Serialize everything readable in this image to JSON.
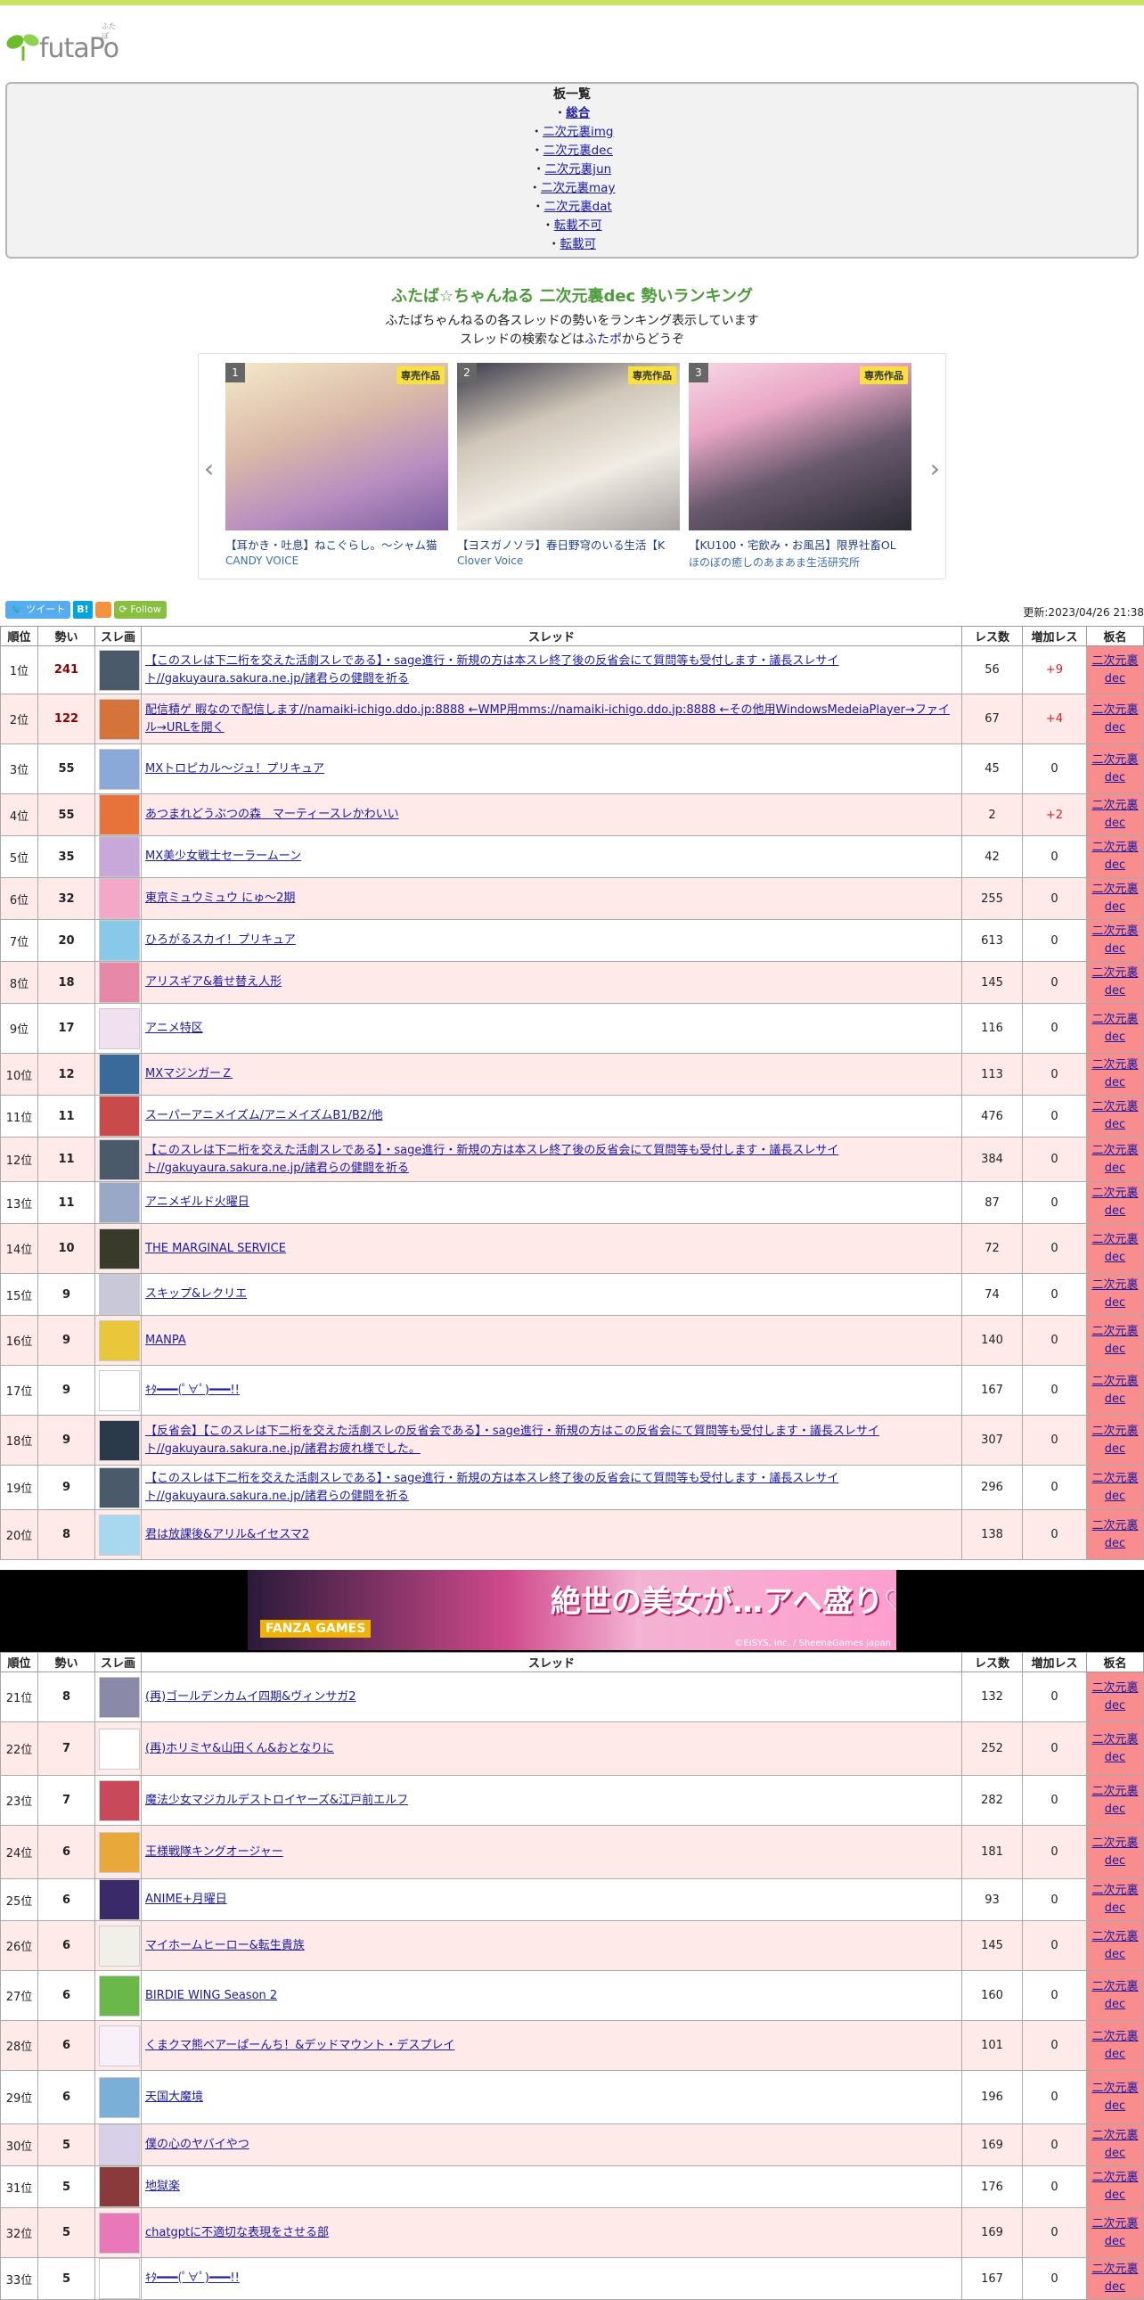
{
  "site": {
    "logo_text": "futaPo",
    "logo_kana": "ふたぽ"
  },
  "boards": {
    "heading": "板一覧",
    "items": [
      "総合",
      "二次元裏img",
      "二次元裏dec",
      "二次元裏jun",
      "二次元裏may",
      "二次元裏dat",
      "転載不可",
      "転載可"
    ]
  },
  "page": {
    "title": "ふたば☆ちゃんねる 二次元裏dec 勢いランキング",
    "desc1": "ふたばちゃんねるの各スレッドの勢いをランキング表示しています",
    "desc2_pre": "スレッドの検索などは",
    "desc2_link": "ふたポ",
    "desc2_post": "からどうぞ",
    "updated": "更新:2023/04/26 21:38"
  },
  "carousel": [
    {
      "num": "1",
      "tag": "専売作品",
      "title": "【耳かき・吐息】ねこぐらし。〜シャム猫",
      "circle": "CANDY VOICE"
    },
    {
      "num": "2",
      "tag": "専売作品",
      "title": "【ヨスガノソラ】春日野穹のいる生活【K",
      "circle": "Clover Voice"
    },
    {
      "num": "3",
      "tag": "専売作品",
      "title": "【KU100・宅飲み・お風呂】限界社畜OL",
      "circle": "ほのぼの癒しのあまあま生活研究所"
    }
  ],
  "social": {
    "tweet": "ツイート",
    "hatena": "B!",
    "follow": "Follow"
  },
  "table_headers": [
    "順位",
    "勢い",
    "スレ画",
    "スレッド",
    "レス数",
    "増加レス",
    "板名"
  ],
  "rows_a": [
    {
      "rank": "1位",
      "mom": "241",
      "title": "【このスレは下二桁を交えた活劇スレである】・sage進行・新規の方は本スレ終了後の反省会にて質問等も受付します・議長スレサイト//gakuyaura.sakura.ne.jp/諸君らの健闘を祈る",
      "res": "56",
      "inc": "+9",
      "board": "二次元裏dec"
    },
    {
      "rank": "2位",
      "mom": "122",
      "title": "配信積ゲ 暇なので配信します//namaiki-ichigo.ddo.jp:8888 ←WMP用mms://namaiki-ichigo.ddo.jp:8888 ←その他用WindowsMedeiaPlayer→ファイル→URLを開く",
      "res": "67",
      "inc": "+4",
      "board": "二次元裏dec"
    },
    {
      "rank": "3位",
      "mom": "55",
      "title": "MXトロピカル～ジュ！プリキュア",
      "res": "45",
      "inc": "0",
      "board": "二次元裏dec"
    },
    {
      "rank": "4位",
      "mom": "55",
      "title": "あつまれどうぶつの森　マーティースレかわいい",
      "res": "2",
      "inc": "+2",
      "board": "二次元裏dec"
    },
    {
      "rank": "5位",
      "mom": "35",
      "title": "MX美少女戦士セーラームーン",
      "res": "42",
      "inc": "0",
      "board": "二次元裏dec"
    },
    {
      "rank": "6位",
      "mom": "32",
      "title": "東京ミュウミュウ にゅ～2期",
      "res": "255",
      "inc": "0",
      "board": "二次元裏dec"
    },
    {
      "rank": "7位",
      "mom": "20",
      "title": "ひろがるスカイ！プリキュア",
      "res": "613",
      "inc": "0",
      "board": "二次元裏dec"
    },
    {
      "rank": "8位",
      "mom": "18",
      "title": "アリスギア&着せ替え人形",
      "res": "145",
      "inc": "0",
      "board": "二次元裏dec"
    },
    {
      "rank": "9位",
      "mom": "17",
      "title": "アニメ特区",
      "res": "116",
      "inc": "0",
      "board": "二次元裏dec"
    },
    {
      "rank": "10位",
      "mom": "12",
      "title": "MXマジンガーＺ",
      "res": "113",
      "inc": "0",
      "board": "二次元裏dec"
    },
    {
      "rank": "11位",
      "mom": "11",
      "title": "スーパーアニメイズム/アニメイズムB1/B2/他",
      "res": "476",
      "inc": "0",
      "board": "二次元裏dec"
    },
    {
      "rank": "12位",
      "mom": "11",
      "title": "【このスレは下二桁を交えた活劇スレである】・sage進行・新規の方は本スレ終了後の反省会にて質問等も受付します・議長スレサイト//gakuyaura.sakura.ne.jp/諸君らの健闘を祈る",
      "res": "384",
      "inc": "0",
      "board": "二次元裏dec"
    },
    {
      "rank": "13位",
      "mom": "11",
      "title": "アニメギルド火曜日",
      "res": "87",
      "inc": "0",
      "board": "二次元裏dec"
    },
    {
      "rank": "14位",
      "mom": "10",
      "title": "THE MARGINAL SERVICE",
      "res": "72",
      "inc": "0",
      "board": "二次元裏dec"
    },
    {
      "rank": "15位",
      "mom": "9",
      "title": "スキップ&レクリエ",
      "res": "74",
      "inc": "0",
      "board": "二次元裏dec"
    },
    {
      "rank": "16位",
      "mom": "9",
      "title": "MANPA",
      "res": "140",
      "inc": "0",
      "board": "二次元裏dec"
    },
    {
      "rank": "17位",
      "mom": "9",
      "title": "ｷﾀ━━━(ﾟ∀ﾟ)━━━!!",
      "res": "167",
      "inc": "0",
      "board": "二次元裏dec"
    },
    {
      "rank": "18位",
      "mom": "9",
      "title": "【反省会】【このスレは下二桁を交えた活劇スレの反省会である】・sage進行・新規の方はこの反省会にて質問等も受付します・議長スレサイト//gakuyaura.sakura.ne.jp/諸君お疲れ様でした。",
      "res": "307",
      "inc": "0",
      "board": "二次元裏dec"
    },
    {
      "rank": "19位",
      "mom": "9",
      "title": "【このスレは下二桁を交えた活劇スレである】・sage進行・新規の方は本スレ終了後の反省会にて質問等も受付します・議長スレサイト//gakuyaura.sakura.ne.jp/諸君らの健闘を祈る",
      "res": "296",
      "inc": "0",
      "board": "二次元裏dec"
    },
    {
      "rank": "20位",
      "mom": "8",
      "title": "君は放課後&アリル&イセスマ2",
      "res": "138",
      "inc": "0",
      "board": "二次元裏dec"
    }
  ],
  "rows_b": [
    {
      "rank": "21位",
      "mom": "8",
      "title": "(再)ゴールデンカムイ四期&ヴィンサガ2",
      "res": "132",
      "inc": "0",
      "board": "二次元裏dec"
    },
    {
      "rank": "22位",
      "mom": "7",
      "title": "(再)ホリミヤ&山田くん&おとなりに",
      "res": "252",
      "inc": "0",
      "board": "二次元裏dec"
    },
    {
      "rank": "23位",
      "mom": "7",
      "title": "魔法少女マジカルデストロイヤーズ&江戸前エルフ",
      "res": "282",
      "inc": "0",
      "board": "二次元裏dec"
    },
    {
      "rank": "24位",
      "mom": "6",
      "title": "王様戦隊キングオージャー",
      "res": "181",
      "inc": "0",
      "board": "二次元裏dec"
    },
    {
      "rank": "25位",
      "mom": "6",
      "title": "ANIME+月曜日",
      "res": "93",
      "inc": "0",
      "board": "二次元裏dec"
    },
    {
      "rank": "26位",
      "mom": "6",
      "title": "マイホームヒーロー&転生貴族",
      "res": "145",
      "inc": "0",
      "board": "二次元裏dec"
    },
    {
      "rank": "27位",
      "mom": "6",
      "title": "BIRDIE WING Season 2",
      "res": "160",
      "inc": "0",
      "board": "二次元裏dec"
    },
    {
      "rank": "28位",
      "mom": "6",
      "title": "くまクマ熊ベアーぱーんち！&デッドマウント・デスプレイ",
      "res": "101",
      "inc": "0",
      "board": "二次元裏dec"
    },
    {
      "rank": "29位",
      "mom": "6",
      "title": "天国大魔境",
      "res": "196",
      "inc": "0",
      "board": "二次元裏dec"
    },
    {
      "rank": "30位",
      "mom": "5",
      "title": "僕の心のヤバイやつ",
      "res": "169",
      "inc": "0",
      "board": "二次元裏dec"
    },
    {
      "rank": "31位",
      "mom": "5",
      "title": "地獄楽",
      "res": "176",
      "inc": "0",
      "board": "二次元裏dec"
    },
    {
      "rank": "32位",
      "mom": "5",
      "title": "chatgptに不適切な表現をさせる部",
      "res": "169",
      "inc": "0",
      "board": "二次元裏dec"
    },
    {
      "rank": "33位",
      "mom": "5",
      "title": "ｷﾀ━━━(ﾟ∀ﾟ)━━━!!",
      "res": "167",
      "inc": "0",
      "board": "二次元裏dec"
    }
  ],
  "banner": {
    "text": "絶世の美女が…アヘ盛り♡",
    "brand": "FANZA GAMES",
    "credit": "©EISYS, Inc. / SheenaGames Japan"
  },
  "colors": {
    "accent_bar": "#c9e265",
    "title_green": "#4c9a3a",
    "row_alt": "#ffeaea",
    "board_cell": "#f98c8c",
    "link": "#1a1aa6",
    "increase": "#e02020"
  }
}
